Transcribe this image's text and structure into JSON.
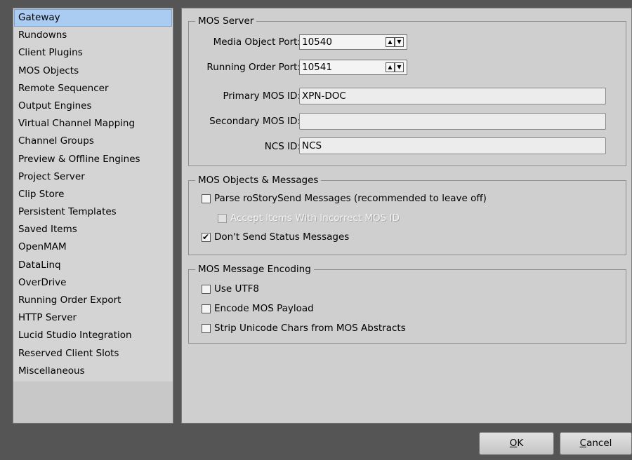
{
  "sidebar": {
    "items": [
      {
        "label": "Gateway",
        "selected": true
      },
      {
        "label": "Rundowns"
      },
      {
        "label": "Client Plugins"
      },
      {
        "label": "MOS Objects"
      },
      {
        "label": "Remote Sequencer"
      },
      {
        "label": "Output Engines"
      },
      {
        "label": "Virtual Channel Mapping"
      },
      {
        "label": "Channel Groups"
      },
      {
        "label": "Preview & Offline Engines"
      },
      {
        "label": "Project Server"
      },
      {
        "label": "Clip Store"
      },
      {
        "label": "Persistent Templates"
      },
      {
        "label": "Saved Items"
      },
      {
        "label": "OpenMAM"
      },
      {
        "label": "DataLinq"
      },
      {
        "label": "OverDrive"
      },
      {
        "label": "Running Order Export"
      },
      {
        "label": "HTTP Server"
      },
      {
        "label": "Lucid Studio Integration"
      },
      {
        "label": "Reserved Client Slots"
      },
      {
        "label": "Miscellaneous"
      }
    ]
  },
  "mos_server": {
    "title": "MOS Server",
    "media_object_port_label": "Media Object Port:",
    "media_object_port_value": "10540",
    "running_order_port_label": "Running Order Port:",
    "running_order_port_value": "10541",
    "primary_mos_id_label": "Primary MOS ID:",
    "primary_mos_id_value": "XPN-DOC",
    "secondary_mos_id_label": "Secondary MOS ID:",
    "secondary_mos_id_value": "",
    "ncs_id_label": "NCS ID:",
    "ncs_id_value": "NCS"
  },
  "mos_objects": {
    "title": "MOS Objects & Messages",
    "parse_label": "Parse roStorySend Messages (recommended to leave off)",
    "parse_checked": false,
    "accept_label": "Accept Items With Incorrect MOS ID",
    "accept_checked": false,
    "accept_disabled": true,
    "dont_send_label": "Don't Send Status Messages",
    "dont_send_checked": true
  },
  "mos_encoding": {
    "title": "MOS Message Encoding",
    "utf8_label": "Use UTF8",
    "utf8_checked": false,
    "encode_label": "Encode MOS Payload",
    "encode_checked": false,
    "strip_label": "Strip Unicode Chars from MOS Abstracts",
    "strip_checked": false
  },
  "footer": {
    "ok_mnemonic": "O",
    "ok_rest": "K",
    "cancel_mnemonic": "C",
    "cancel_rest": "ancel"
  },
  "icons": {
    "spin_up": "spin-up-arrow-icon",
    "spin_down": "spin-down-arrow-icon",
    "check": "checkmark-icon"
  },
  "colors": {
    "selection": "#aacbf2",
    "background": "#555555",
    "panel": "#cfcfcf"
  }
}
